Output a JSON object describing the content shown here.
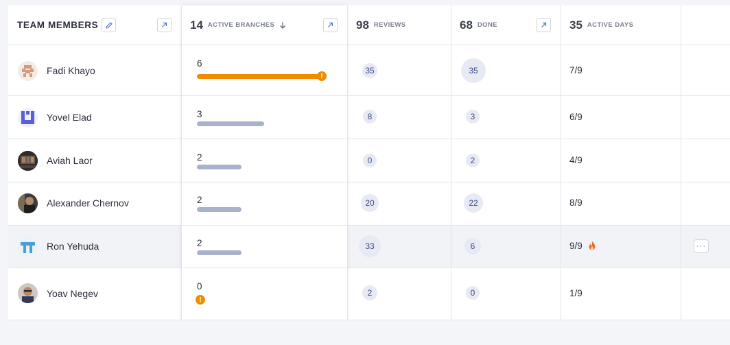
{
  "header": {
    "team_members": "TEAM MEMBERS",
    "branches": {
      "value": "14",
      "label": "ACTIVE BRANCHES"
    },
    "reviews": {
      "value": "98",
      "label": "REVIEWS"
    },
    "done": {
      "value": "68",
      "label": "DONE"
    },
    "active_days": {
      "value": "35",
      "label": "ACTIVE DAYS"
    }
  },
  "rows": [
    {
      "name": "Fadi Khayo",
      "branches": "6",
      "bar_fraction": 1.0,
      "bar_color": "#f08c00",
      "warning": true,
      "reviews": "35",
      "done": "35",
      "days": "7/9",
      "fire": false
    },
    {
      "name": "Yovel Elad",
      "branches": "3",
      "bar_fraction": 0.5,
      "bar_color": "#aab1cc",
      "warning": false,
      "reviews": "8",
      "done": "3",
      "days": "6/9",
      "fire": false
    },
    {
      "name": "Aviah Laor",
      "branches": "2",
      "bar_fraction": 0.333,
      "bar_color": "#aab1cc",
      "warning": false,
      "reviews": "0",
      "done": "2",
      "days": "4/9",
      "fire": false
    },
    {
      "name": "Alexander Chernov",
      "branches": "2",
      "bar_fraction": 0.333,
      "bar_color": "#aab1cc",
      "warning": false,
      "reviews": "20",
      "done": "22",
      "days": "8/9",
      "fire": false
    },
    {
      "name": "Ron Yehuda",
      "branches": "2",
      "bar_fraction": 0.333,
      "bar_color": "#aab1cc",
      "warning": false,
      "reviews": "33",
      "done": "6",
      "days": "9/9",
      "fire": true,
      "highlighted": true,
      "more": "···"
    },
    {
      "name": "Yoav Negev",
      "branches": "0",
      "bar_fraction": 0,
      "bar_color": "#aab1cc",
      "warning": true,
      "reviews": "2",
      "done": "0",
      "days": "1/9",
      "fire": false
    }
  ],
  "icons": {
    "edit": "pencil-icon",
    "expand": "arrow-up-right-icon",
    "sort": "arrow-down-icon",
    "warning": "exclamation-icon",
    "fire": "fire-icon",
    "more": "ellipsis-icon"
  },
  "colors": {
    "warning": "#f08c00",
    "bar": "#aab1cc",
    "bubble_bg": "#e7e9f3",
    "bubble_text": "#3d4a86",
    "fire": "#e0703a"
  }
}
